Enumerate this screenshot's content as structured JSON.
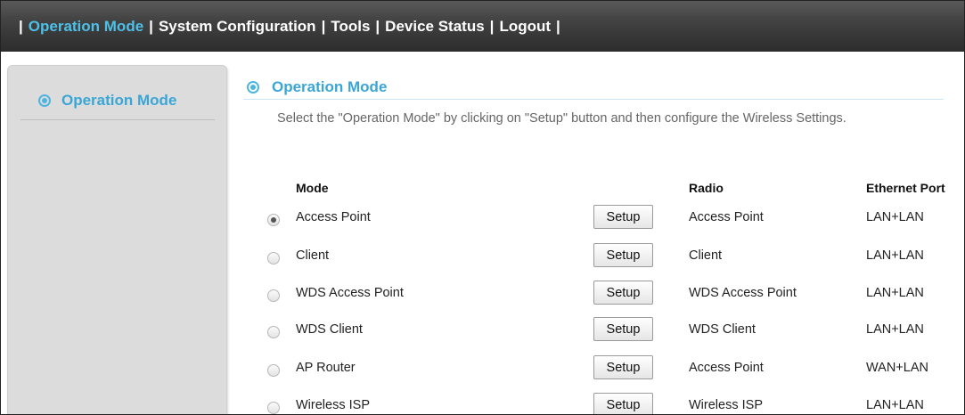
{
  "nav": {
    "items": [
      {
        "label": "Operation Mode",
        "active": true
      },
      {
        "label": "System Configuration",
        "active": false
      },
      {
        "label": "Tools",
        "active": false
      },
      {
        "label": "Device Status",
        "active": false
      },
      {
        "label": "Logout",
        "active": false
      }
    ],
    "separator": "|"
  },
  "sidebar": {
    "items": [
      {
        "label": "Operation Mode",
        "icon": "target-icon"
      }
    ]
  },
  "main": {
    "title": "Operation Mode",
    "description": "Select the \"Operation Mode\" by clicking on \"Setup\" button and then configure the Wireless Settings.",
    "columns": {
      "mode": "Mode",
      "radio": "Radio",
      "ethernet": "Ethernet Port"
    },
    "rows": [
      {
        "mode": "Access Point",
        "button": "Setup",
        "radio": "Access Point",
        "ethernet": "LAN+LAN",
        "selected": true
      },
      {
        "mode": "Client",
        "button": "Setup",
        "radio": "Client",
        "ethernet": "LAN+LAN",
        "selected": false
      },
      {
        "mode": "WDS Access Point",
        "button": "Setup",
        "radio": "WDS Access Point",
        "ethernet": "LAN+LAN",
        "selected": false
      },
      {
        "mode": "WDS Client",
        "button": "Setup",
        "radio": "WDS Client",
        "ethernet": "LAN+LAN",
        "selected": false
      },
      {
        "mode": "AP Router",
        "button": "Setup",
        "radio": "Access Point",
        "ethernet": "WAN+LAN",
        "selected": false
      },
      {
        "mode": "Wireless ISP",
        "button": "Setup",
        "radio": "Wireless ISP",
        "ethernet": "LAN+LAN",
        "selected": false
      }
    ]
  },
  "colors": {
    "accent": "#3aa6d6",
    "nav_active": "#4ec0e8",
    "nav_bg": "#3a3a3a",
    "sidebar_bg": "#dcdcdc"
  }
}
